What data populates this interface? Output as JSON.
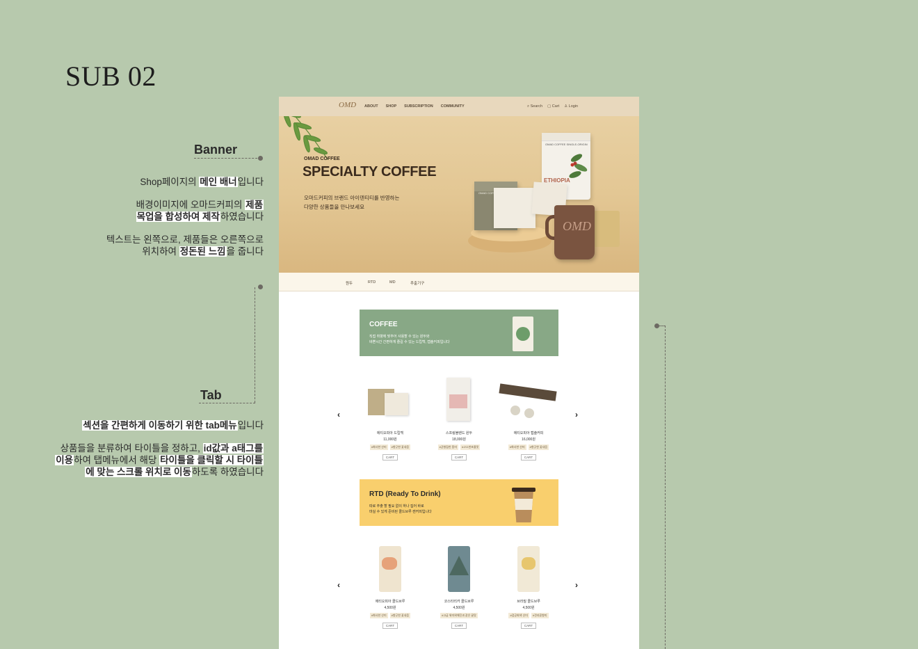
{
  "page": {
    "title": "SUB 02"
  },
  "annotations": {
    "banner": {
      "heading": "Banner",
      "p1": [
        "Shop페이지의 ",
        "메인 배너",
        "입니다"
      ],
      "p2a": [
        "배경이미지에 오마드커피의 ",
        "제품"
      ],
      "p2b": [
        "목업을 합성하여 제작",
        "하였습니다"
      ],
      "p3a": "텍스트는 왼쪽으로, 제품들은 오른쪽으로",
      "p3b": [
        "위치하여 ",
        "정돈된 느낌",
        "을 줍니다"
      ]
    },
    "tab": {
      "heading": "Tab",
      "p1": [
        "섹션을 간편하게 이동하기 위한 tab메뉴",
        "입니다"
      ],
      "p2a": [
        "상품들을 분류하여 타이틀을 정하고, ",
        "id값과 a태그를"
      ],
      "p2b": [
        "이용",
        "하여 탭메뉴에서 해당 ",
        "타이틀을 클릭할 시 타이틀"
      ],
      "p2c": [
        "에 맞는 스크롤 위치로 이동",
        "하도록 하였습니다"
      ]
    }
  },
  "mockup": {
    "nav": {
      "logo": "OMD",
      "menu": [
        "ABOUT",
        "SHOP",
        "SUBSCRIPTION",
        "COMMUNITY"
      ],
      "search": "Search",
      "cart": "Cart",
      "login": "Login"
    },
    "banner": {
      "brand": "OMAD COFFEE",
      "title": "SPECIALTY COFFEE",
      "desc1": "오마드커피의 브랜드 아이덴티티를 반영하는",
      "desc2": "다양한 상품들을 만나보세요",
      "bag_label": "OMAD COFFEE SINGLE-ORIGIN",
      "bag_origin": "ETHIOPIA",
      "box_label": "OMAD COFFEE DRIP BAG",
      "mug_logo": "OMD"
    },
    "tabs": [
      "원두",
      "RTD",
      "MD",
      "추출기구"
    ],
    "coffee_section": {
      "title": "COFFEE",
      "desc1": "직접 취향에 맞추어 사용할 수 있는 원두와",
      "desc2": "바쁜시간 간편하게 즐길 수 있는 드립백, 캡슐커피입니다",
      "color": "#88a886"
    },
    "coffee_products": [
      {
        "name": "에티오피아 드립백",
        "price": "11,000원",
        "tags": [
          "#화사한 산미",
          "#향긋한 꽃내음"
        ],
        "cart": "CART"
      },
      {
        "name": "스프링블렌드 원두",
        "price": "18,000원",
        "tags": [
          "#균형잡힌 풍미",
          "#고소한초콜릿"
        ],
        "cart": "CART"
      },
      {
        "name": "에티오피아 캡슐커피",
        "price": "16,000원",
        "tags": [
          "#화사한 산미",
          "#향긋한 꽃내음"
        ],
        "cart": "CART"
      }
    ],
    "rtd_section": {
      "title": "RTD (Ready To Drink)",
      "desc1": "따로 추출 할 필요 없이 하나 집어 바로",
      "desc2": "마실 수 있게 준비된 콜드브루 캔커피입니다",
      "color": "#f9cf6d"
    },
    "rtd_products": [
      {
        "name": "에티오피아 콜드브루",
        "price": "4,500원",
        "tags": [
          "#화사한 산미",
          "#향긋한 꽃내음"
        ],
        "cart": "CART"
      },
      {
        "name": "코스타리카 콜드브루",
        "price": "4,500원",
        "tags": [
          "#고급 위미위해진과 같은 끝맛"
        ],
        "cart": "CART"
      },
      {
        "name": "브라질 콜드브루",
        "price": "4,500원",
        "tags": [
          "#검공회색 산미",
          "#견과류향미"
        ],
        "cart": "CART"
      }
    ],
    "can_label": "OMAD COFFEE COLD BREW",
    "arrows": {
      "prev": "‹",
      "next": "›"
    }
  }
}
